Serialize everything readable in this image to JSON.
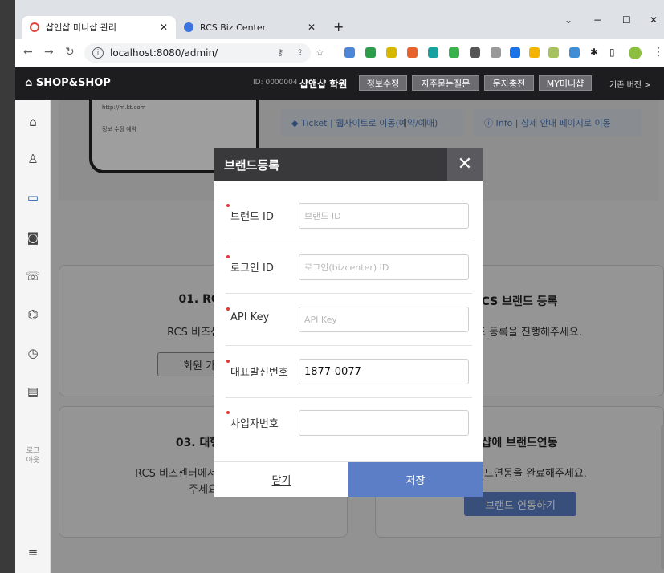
{
  "browser": {
    "tabs": [
      {
        "label": "샵앤샵 미니샵 관리",
        "active": true
      },
      {
        "label": "RCS Biz Center",
        "active": false
      }
    ],
    "url": "localhost:8080/admin/",
    "window_controls": {
      "minimize": "−",
      "maximize": "☐",
      "close": "✕",
      "chevron": "⌄"
    }
  },
  "header": {
    "logo": "⌂ SHOP&SHOP",
    "id_text": "ID: 0000004",
    "shop_name": "샵앤샵 학원",
    "buttons": [
      "정보수정",
      "자주묻는질문",
      "문자충전",
      "MY미니샵"
    ],
    "legacy": "기존 버전 >"
  },
  "sidebar": {
    "icons": [
      "home-icon",
      "user-icon",
      "message-icon",
      "chat-icon",
      "phone-icon",
      "wifi-icon",
      "clock-icon",
      "card-icon"
    ],
    "logout": "로그\n아웃"
  },
  "background": {
    "phone_lines": [
      "http://m.kt.com",
      "정보 수정 예약"
    ],
    "chips": [
      {
        "label": "◆ Ticket  |  웹사이트로 이동(예약/예매)"
      },
      {
        "label": "ⓘ Info  |  상세 안내 페이지로 이동"
      }
    ],
    "cards": [
      {
        "title": "01. RCS",
        "desc": "RCS 비즈센터에",
        "button": "회원 가입"
      },
      {
        "title": "CS 브랜드 등록",
        "desc": "브랜드 등록을 진행해주세요.",
        "button": ""
      },
      {
        "title": "03. 대행사",
        "desc": "RCS 비즈센터에서 대행사 권한\n주세요",
        "button": ""
      },
      {
        "title": "샵에 브랜드연동",
        "desc": "며 브랜드연동을 완료해주세요.",
        "button": "브랜드 연동하기"
      }
    ]
  },
  "modal": {
    "title": "브랜드등록",
    "fields": [
      {
        "label": "브랜드 ID",
        "placeholder": "브랜드 ID",
        "value": ""
      },
      {
        "label": "로그인 ID",
        "placeholder": "로그인(bizcenter) ID",
        "value": ""
      },
      {
        "label": "API Key",
        "placeholder": "API Key",
        "value": ""
      },
      {
        "label": "대표발신번호",
        "placeholder": "",
        "value": "1877-0077"
      },
      {
        "label": "사업자번호",
        "placeholder": "",
        "value": ""
      }
    ],
    "close_label": "닫기",
    "save_label": "저장"
  },
  "colors": {
    "save": "#5b7ec7",
    "header": "#1d1d1f",
    "required": "#e53935"
  }
}
